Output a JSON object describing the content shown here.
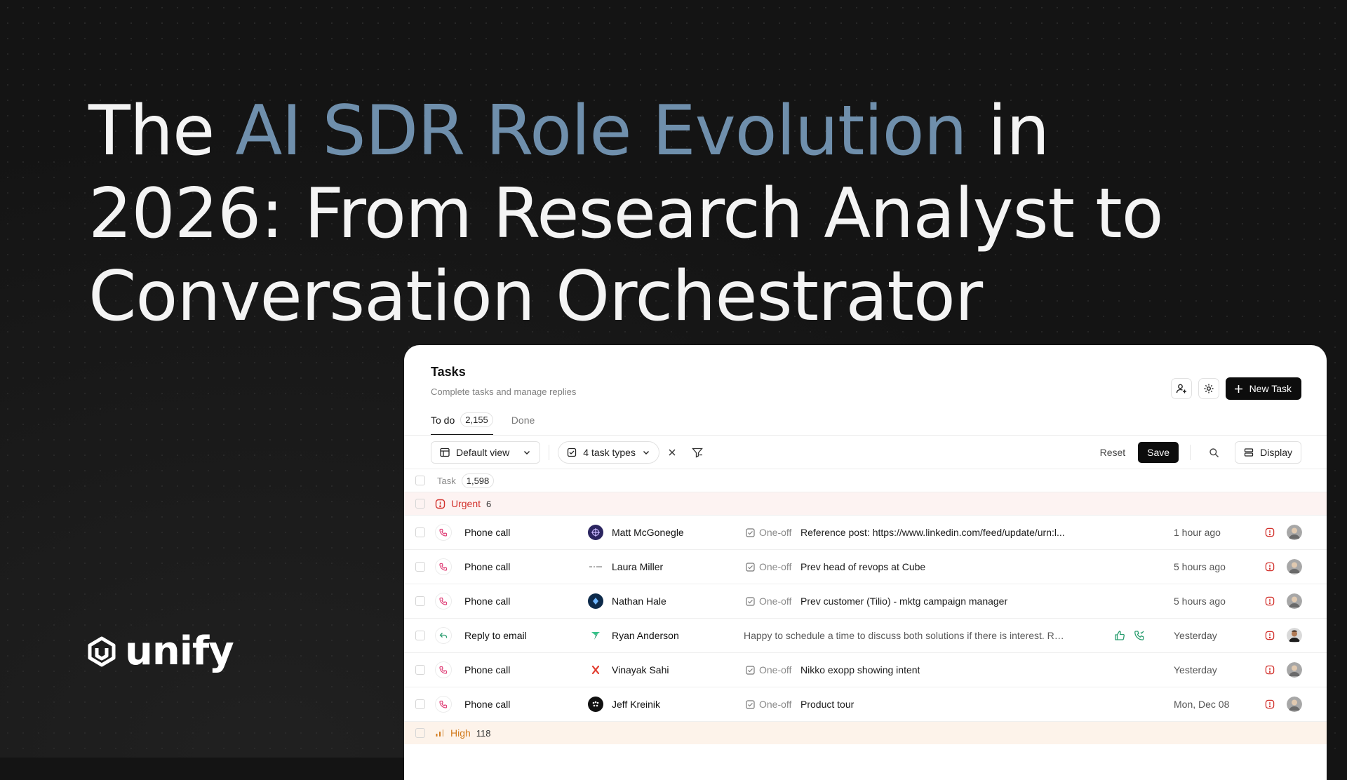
{
  "headline": {
    "part1": "The ",
    "accent": "AI SDR Role Evolution",
    "part2": " in 2026: From Research Analyst to Conversation Orchestrator"
  },
  "brand": {
    "name": "unify",
    "accent_color": "#6f8fac"
  },
  "app": {
    "title": "Tasks",
    "subtitle": "Complete tasks and manage replies",
    "new_task_label": "New Task",
    "tabs": [
      {
        "label": "To do",
        "count": "2,155",
        "active": true
      },
      {
        "label": "Done",
        "active": false
      }
    ],
    "toolbar": {
      "view_label": "Default view",
      "filter_label": "4 task types",
      "reset_label": "Reset",
      "save_label": "Save",
      "display_label": "Display"
    },
    "table": {
      "header_label": "Task",
      "header_count": "1,598",
      "urgent": {
        "label": "Urgent",
        "count": "6",
        "rows": [
          {
            "task": "Phone call",
            "icon": "phone-icon",
            "contact": "Matt McGonegle",
            "type": "One-off",
            "description": "Reference post: https://www.linkedin.com/feed/update/urn:l...",
            "time": "1 hour ago"
          },
          {
            "task": "Phone call",
            "icon": "phone-icon",
            "contact": "Laura Miller",
            "type": "One-off",
            "description": "Prev head of revops at Cube",
            "time": "5 hours ago"
          },
          {
            "task": "Phone call",
            "icon": "phone-icon",
            "contact": "Nathan Hale",
            "type": "One-off",
            "description": "Prev customer (Tilio) - mktg campaign manager",
            "time": "5 hours ago"
          },
          {
            "task": "Reply to email",
            "icon": "reply-icon",
            "contact": "Ryan Anderson",
            "type": "",
            "description": "Happy to schedule a time to discuss both solutions if there is interest. Ry...",
            "time": "Yesterday"
          },
          {
            "task": "Phone call",
            "icon": "phone-icon",
            "contact": "Vinayak Sahi",
            "type": "One-off",
            "description": "Nikko exopp showing intent",
            "time": "Yesterday"
          },
          {
            "task": "Phone call",
            "icon": "phone-icon",
            "contact": "Jeff Kreinik",
            "type": "One-off",
            "description": "Product tour",
            "time": "Mon, Dec 08"
          }
        ]
      },
      "high": {
        "label": "High",
        "count": "118"
      }
    }
  },
  "colors": {
    "urgent": "#d2322d",
    "high": "#d27a1c",
    "phone": "#e0457b",
    "reply": "#2a9d6f"
  }
}
